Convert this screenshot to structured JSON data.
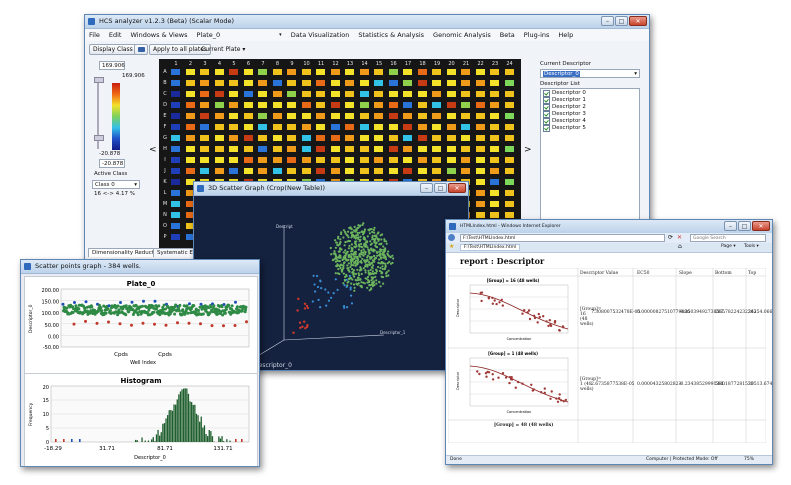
{
  "main_window": {
    "title": "HCS analyzer v1.2.3 (Beta) (Scalar Mode)",
    "menu": [
      "File",
      "Edit",
      "Windows & Views",
      "Plate_0",
      "Data Visualization",
      "Statistics & Analysis",
      "Genomic Analysis",
      "Beta",
      "Plug-ins",
      "Help"
    ],
    "menu_dropdown_glyph": "▾",
    "toolbar": {
      "display_class": "Display Class",
      "apply_all": "Apply to all plates",
      "current_plate": "Current Plate ▾"
    },
    "scale": {
      "max_value": "169.906",
      "max_label": "169.906",
      "min_label": "-20.878",
      "min_value": "-20.878"
    },
    "active_class_label": "Active Class",
    "class_select": "Class 0",
    "class_stats": "16 <-> 4.17 %",
    "nav_left": "<",
    "nav_right": ">",
    "plate_columns": [
      "1",
      "2",
      "3",
      "4",
      "5",
      "6",
      "7",
      "8",
      "9",
      "10",
      "11",
      "12",
      "13",
      "14",
      "15",
      "16",
      "17",
      "18",
      "19",
      "20",
      "21",
      "22",
      "23",
      "24"
    ],
    "plate_rows": [
      "A",
      "B",
      "C",
      "D",
      "E",
      "F",
      "G",
      "H",
      "I",
      "J",
      "K",
      "L",
      "M",
      "N",
      "O",
      "P"
    ],
    "current_descriptor_label": "Current Descriptor",
    "current_descriptor_value": "Descriptor_0",
    "descriptor_list_label": "Descriptor List",
    "descriptors": [
      "Descriptor 0",
      "Descriptor 1",
      "Descriptor 2",
      "Descriptor 3",
      "Descriptor 4",
      "Descriptor 5"
    ],
    "tabs": [
      "Dimensionality Reduction",
      "Systematic Error"
    ]
  },
  "scatter_window": {
    "title": "Scatter points graph - 384 wells.",
    "plot1": {
      "title": "Plate_0",
      "yticks": [
        "200.00",
        "150.00",
        "100.00",
        "50.00",
        "0.00",
        "-50.00"
      ],
      "xticks": [
        "Cpds",
        "Cpds"
      ],
      "xlabel": "Well Index",
      "ylabel": "Descriptor_0"
    },
    "plot2": {
      "title": "Histogram",
      "yticks": [
        "20",
        "15",
        "10",
        "5",
        "0"
      ],
      "xticks": [
        "-18.29",
        "31.71",
        "81.71",
        "131.71"
      ],
      "xlabel": "Descriptor_0",
      "ylabel": "Frequency"
    }
  },
  "graph3d_window": {
    "title": "3D Scatter Graph (Crop(New Table))",
    "axis_y": "Descript",
    "axis_x": "Descriptor_1",
    "axis_z": "Descriptor_0"
  },
  "ie_window": {
    "title": "HTMLIndex.html - Windows Internet Explorer",
    "address": "F:\\Test\\HTMLIndex.html",
    "search_placeholder": "Google Search",
    "tab_label": "F:\\Test\\HTMLIndex.html",
    "toolbar_items": [
      "Page ▾",
      "Tools ▾"
    ],
    "report_title": "report : Descriptor",
    "table_headers": [
      "Descriptor Value",
      "EC50",
      "Slope",
      "Bottom",
      "Top"
    ],
    "rows": [
      {
        "group": "[Group] = 16 (48 wells)",
        "class_cell": "[Group]= 16 (48 wells)",
        "desc": "7.308007532478E-05",
        "ec50": "0.00000827510779486",
        "slope": "-0.25039492738565",
        "bottom": "267.78224232263",
        "top": "34254.066"
      },
      {
        "group": "[Group] = 1 (48 wells)",
        "class_cell": "[Group]= 1 (48 wells)",
        "desc": "2.6735877538E-05",
        "ec50": "0.00004325802823",
        "slope": "-0.23438529991380",
        "bottom": "581.1877281533",
        "top": "30513.674"
      },
      {
        "group": "[Group] = 48 (48 wells)"
      }
    ],
    "chart_xlabel": "Concentration",
    "chart_ylabel": "Descriptor",
    "status_done": "Done",
    "status_zone": "Computer | Protected Mode: Off",
    "zoom": "75%"
  }
}
